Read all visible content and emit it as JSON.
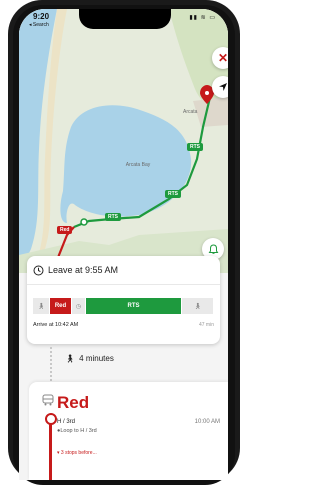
{
  "status_bar": {
    "time": "9:20",
    "back_label": "◂ Search"
  },
  "map": {
    "place_label_1": "Arcata",
    "place_label_2": "Arcata Bay",
    "route_tags": [
      "RTS",
      "RTS",
      "RTS"
    ],
    "red_tag": "Red"
  },
  "trip_card": {
    "leave_text": "Leave at 9:55 AM",
    "segments": {
      "red": "Red",
      "rts": "RTS"
    },
    "arrive_text": "Arrive at 10:42 AM",
    "duration": "47 min"
  },
  "walk": {
    "text": "4 minutes"
  },
  "route_panel": {
    "route_name": "Red",
    "stop_name": "H / 3rd",
    "stop_time": "10:00 AM",
    "loop_text": "●Loop to H / 3rd",
    "stops_before": "▾ 3 stops before..."
  },
  "colors": {
    "route_green": "#1e9a3e",
    "route_red": "#c61a1a",
    "water": "#a9d2e8",
    "land": "#e6ebdc"
  },
  "icons": [
    "close-icon",
    "navigation-arrow-icon",
    "bell-icon",
    "clock-icon",
    "walk-icon",
    "bus-icon",
    "location-pin-icon"
  ]
}
